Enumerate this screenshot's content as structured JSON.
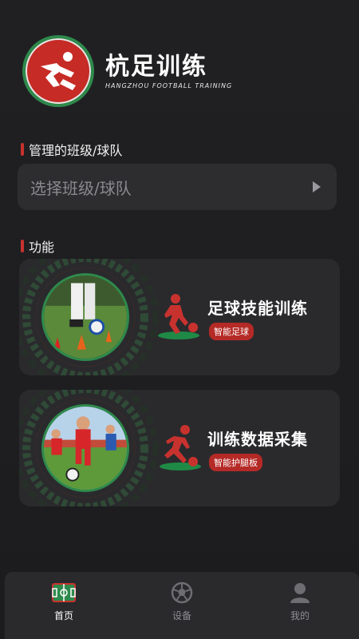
{
  "header": {
    "title": "杭足训练",
    "subtitle": "HANGZHOU FOOTBALL TRAINING",
    "logo_icon": "runner-logo-icon"
  },
  "manage_section": {
    "title": "管理的班级/球队",
    "selector_placeholder": "选择班级/球队"
  },
  "features_section": {
    "title": "功能",
    "cards": [
      {
        "title": "足球技能训练",
        "tag": "智能足球",
        "icon": "dribbling-player-icon"
      },
      {
        "title": "训练数据采集",
        "tag": "智能护腿板",
        "icon": "kicking-player-icon"
      }
    ]
  },
  "tabbar": {
    "tabs": [
      {
        "label": "首页",
        "icon": "pitch-icon",
        "active": true
      },
      {
        "label": "设备",
        "icon": "football-icon",
        "active": false
      },
      {
        "label": "我的",
        "icon": "user-icon",
        "active": false
      }
    ]
  },
  "colors": {
    "accent_red": "#c8322e",
    "accent_green": "#2e8a4c",
    "background": "#1c1c1e",
    "card": "#2a2a2d"
  }
}
